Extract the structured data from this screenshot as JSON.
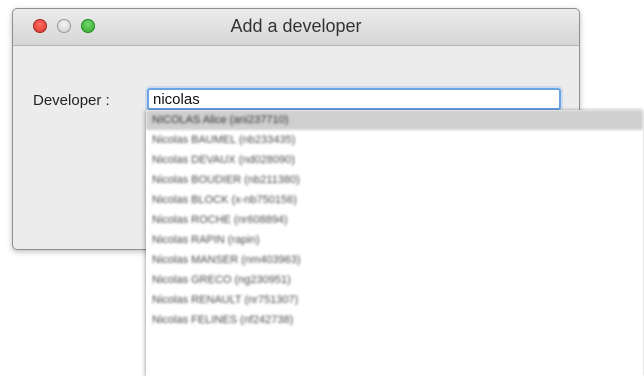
{
  "window": {
    "title": "Add a developer"
  },
  "form": {
    "developer_label": "Developer :",
    "developer_value": "nicolas"
  },
  "dropdown": {
    "items": [
      "NICOLAS Alice (ani237710)",
      "Nicolas BAUMEL (nb233435)",
      "Nicolas DEVAUX (nd028090)",
      "Nicolas BOUDIER (nb211380)",
      "Nicolas BLOCK (x-nb750156)",
      "Nicolas ROCHE (nr608894)",
      "Nicolas RAPIN (rapin)",
      "Nicolas MANSER (nm403963)",
      "Nicolas GRECO (ng230951)",
      "Nicolas RENAULT (nr751307)",
      "Nicolas FELINES (nf242738)"
    ]
  }
}
